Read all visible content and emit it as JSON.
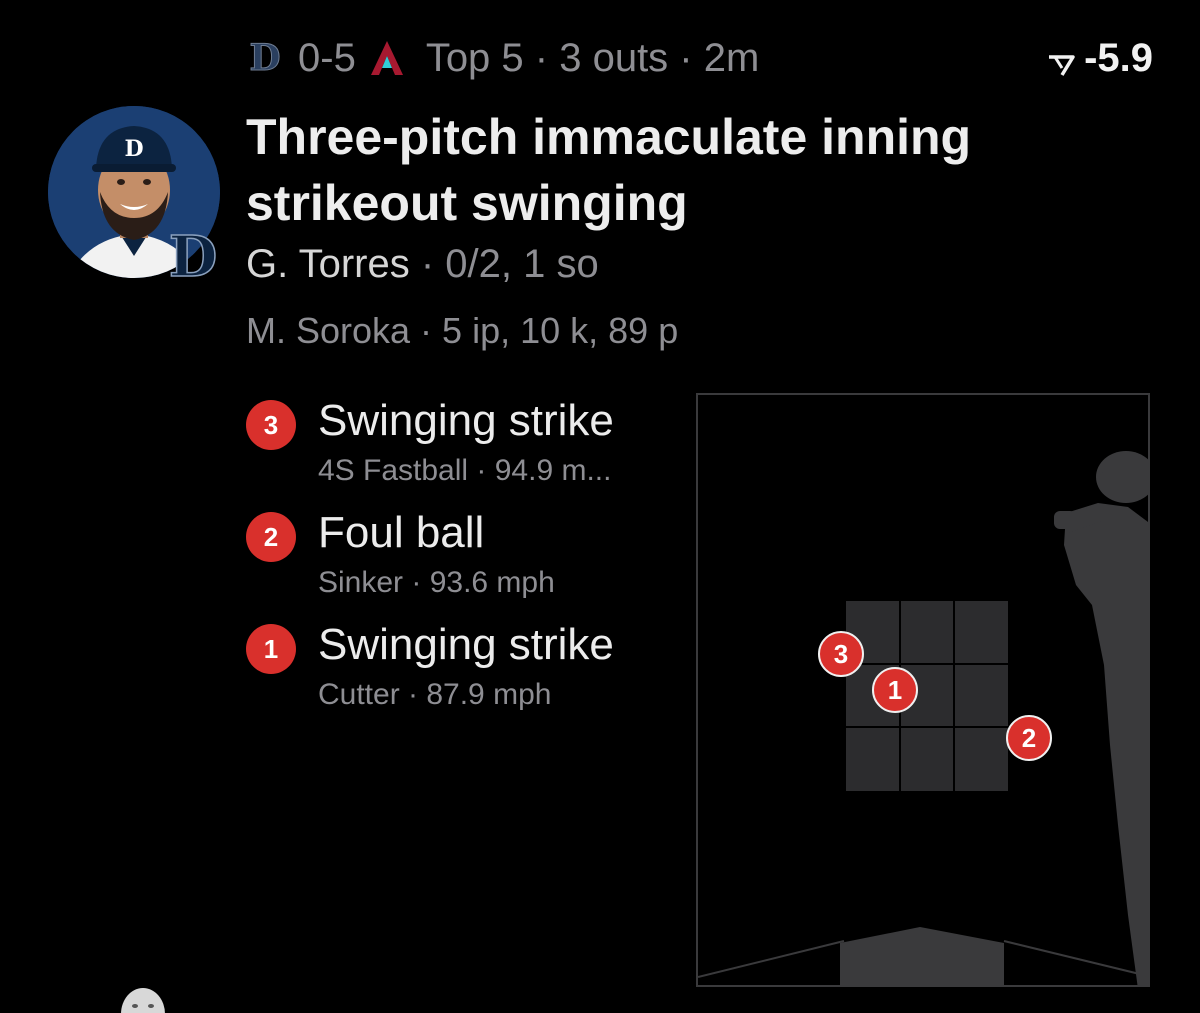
{
  "header": {
    "home_team_icon": "tigers-logo-icon",
    "score": "0-5",
    "away_team_icon": "diamondbacks-logo-icon",
    "game_state": "Top 5 · 3 outs · 2m",
    "win_prob_icon": "win-probability-icon",
    "win_prob_change": "-5.9"
  },
  "player": {
    "avatar": "player-headshot",
    "team_badge_icon": "tigers-d-icon"
  },
  "headline": "Three-pitch immaculate inning strikeout swinging",
  "batter": {
    "name": "G. Torres",
    "stats": " · 0/2, 1 so"
  },
  "pitcher": {
    "line": "M. Soroka · 5 ip, 10 k, 89 p"
  },
  "pitches": [
    {
      "number": "3",
      "result": "Swinging strike",
      "detail": "4S Fastball · 94.9 m..."
    },
    {
      "number": "2",
      "result": "Foul ball",
      "detail": "Sinker · 93.6 mph"
    },
    {
      "number": "1",
      "result": "Swinging strike",
      "detail": "Cutter · 87.9 mph"
    }
  ],
  "zone_markers": [
    "3",
    "1",
    "2"
  ],
  "colors": {
    "background": "#000000",
    "pitch_marker": "#d9302c",
    "zone_fill": "#2c2c2e",
    "muted_text": "#8e8e93"
  }
}
